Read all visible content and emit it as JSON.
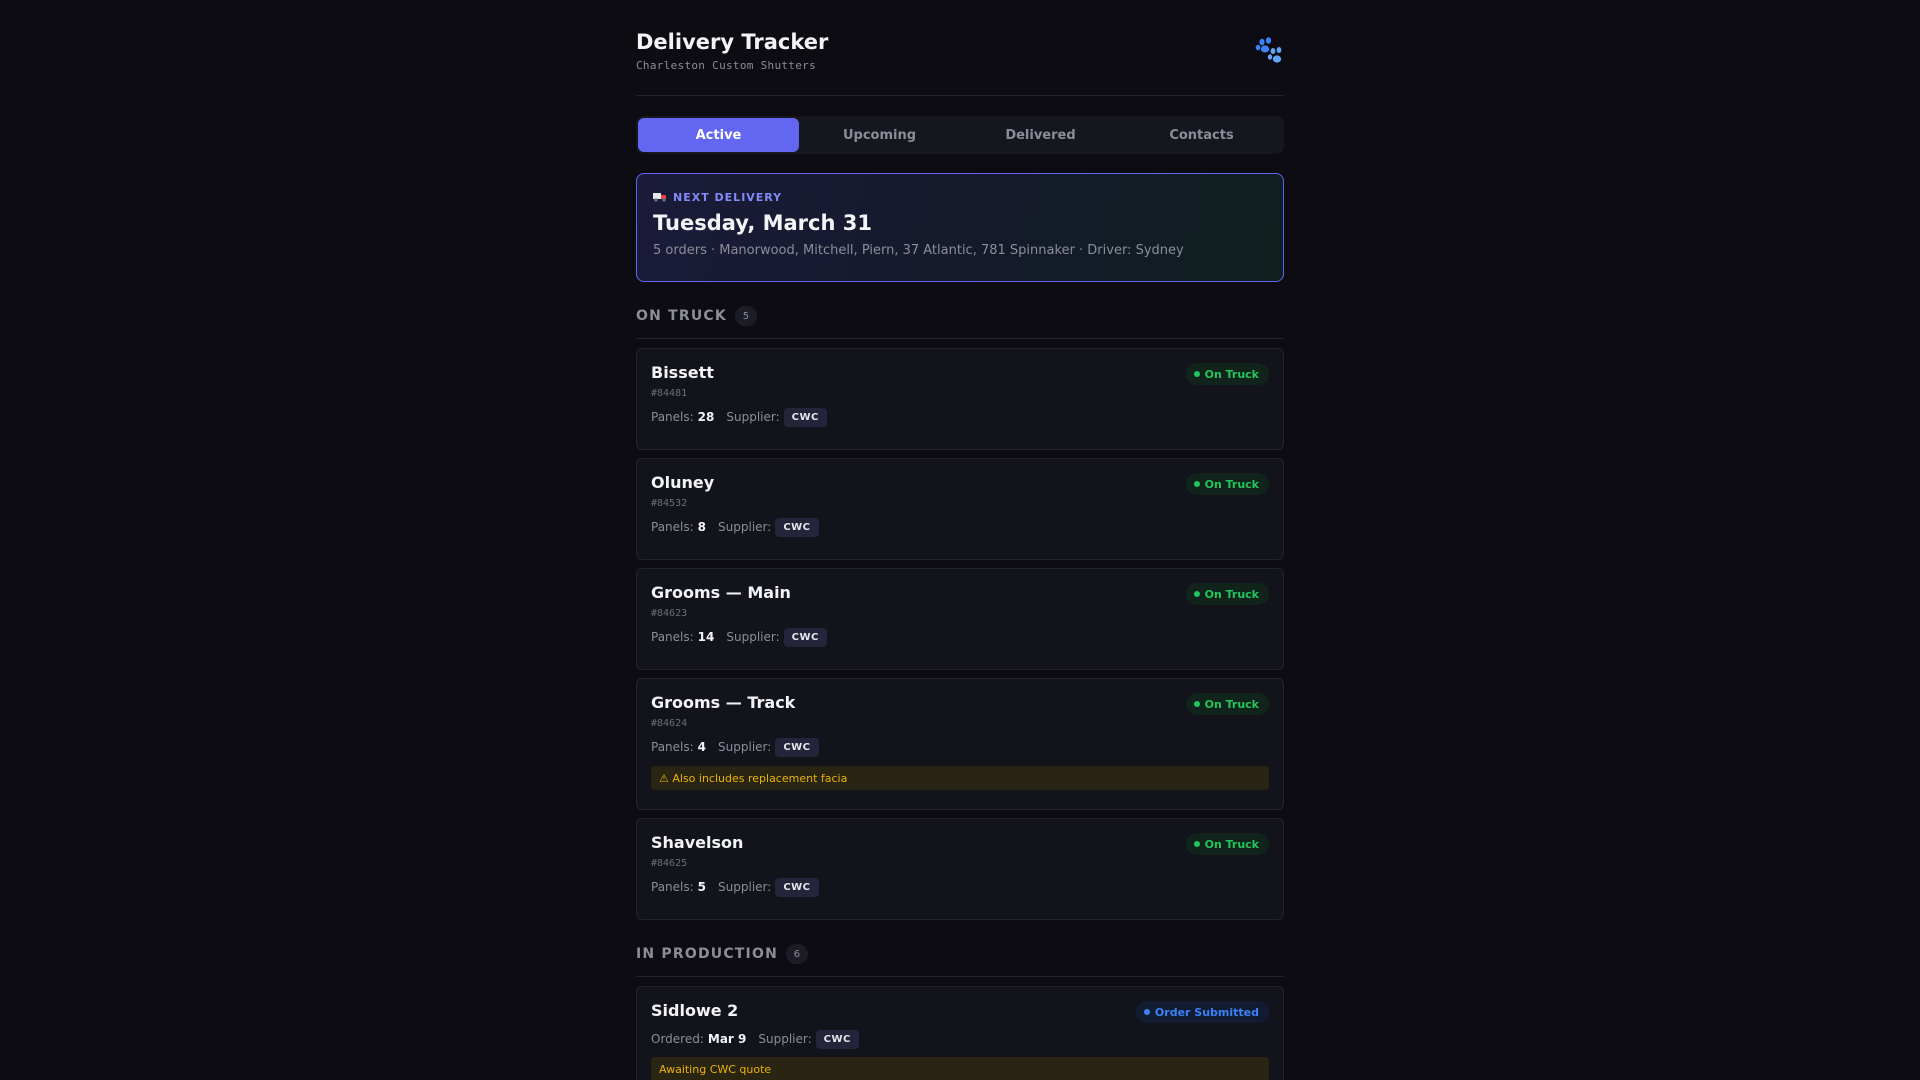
{
  "header": {
    "title": "Delivery Tracker",
    "subtitle": "Charleston Custom Shutters",
    "icon": "paw-icon"
  },
  "tabs": [
    {
      "label": "Active",
      "active": true
    },
    {
      "label": "Upcoming",
      "active": false
    },
    {
      "label": "Delivered",
      "active": false
    },
    {
      "label": "Contacts",
      "active": false
    }
  ],
  "next_delivery": {
    "eyebrow": "NEXT DELIVERY",
    "icon": "truck-icon",
    "date": "Tuesday, March 31",
    "summary": "5 orders · Manorwood, Mitchell, Piern, 37 Atlantic, 781 Spinnaker · Driver: Sydney"
  },
  "on_truck": {
    "title": "ON TRUCK",
    "count": "5",
    "orders": [
      {
        "name": "Bissett",
        "id": "#84481",
        "panels_label": "Panels:",
        "panels": "28",
        "supplier_label": "Supplier:",
        "supplier": "CWC",
        "status": "On Truck"
      },
      {
        "name": "Oluney",
        "id": "#84532",
        "panels_label": "Panels:",
        "panels": "8",
        "supplier_label": "Supplier:",
        "supplier": "CWC",
        "status": "On Truck"
      },
      {
        "name": "Grooms — Main",
        "id": "#84623",
        "panels_label": "Panels:",
        "panels": "14",
        "supplier_label": "Supplier:",
        "supplier": "CWC",
        "status": "On Truck"
      },
      {
        "name": "Grooms — Track",
        "id": "#84624",
        "panels_label": "Panels:",
        "panels": "4",
        "supplier_label": "Supplier:",
        "supplier": "CWC",
        "status": "On Truck",
        "note": "⚠ Also includes replacement facia"
      },
      {
        "name": "Shavelson",
        "id": "#84625",
        "panels_label": "Panels:",
        "panels": "5",
        "supplier_label": "Supplier:",
        "supplier": "CWC",
        "status": "On Truck"
      }
    ]
  },
  "in_production": {
    "title": "IN PRODUCTION",
    "count": "6",
    "orders": [
      {
        "name": "Sidlowe 2",
        "ordered_label": "Ordered:",
        "ordered": "Mar 9",
        "supplier_label": "Supplier:",
        "supplier": "CWC",
        "status": "Order Submitted",
        "note": "Awaiting CWC quote"
      }
    ]
  },
  "colors": {
    "accent": "#6366f1",
    "on_truck": "#22c55e",
    "order_submitted": "#3b82f6",
    "warning": "#eab308"
  }
}
